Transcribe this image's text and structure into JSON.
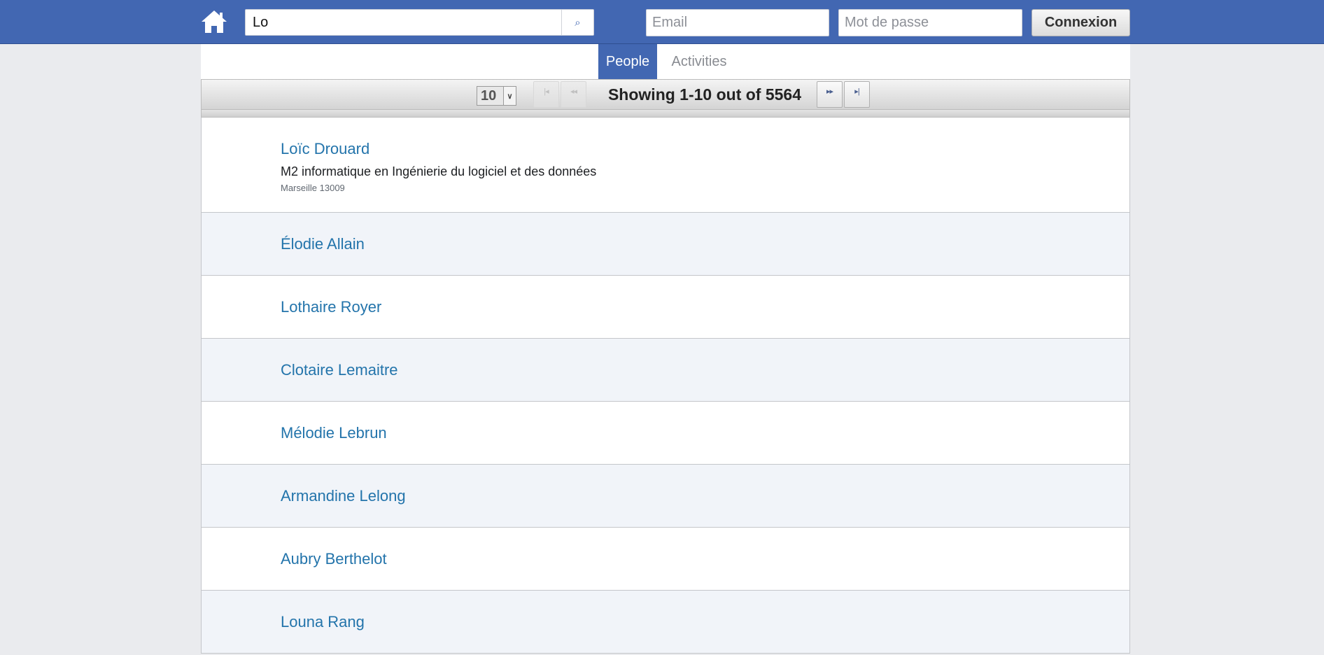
{
  "header": {
    "search_value": "Lo",
    "email_placeholder": "Email",
    "password_placeholder": "Mot de passe",
    "connect_label": "Connexion"
  },
  "tabs": [
    {
      "label": "People"
    },
    {
      "label": "Activities"
    }
  ],
  "pager": {
    "page_size": "10",
    "showing": "Showing 1-10 out of 5564"
  },
  "people": [
    {
      "name": "Loïc Drouard",
      "description": "M2 informatique en Ingénierie du logiciel et des données",
      "location": "Marseille 13009"
    },
    {
      "name": "Élodie Allain"
    },
    {
      "name": "Lothaire Royer"
    },
    {
      "name": "Clotaire Lemaitre"
    },
    {
      "name": "Mélodie Lebrun"
    },
    {
      "name": "Armandine Lelong"
    },
    {
      "name": "Aubry Berthelot"
    },
    {
      "name": "Louna Rang"
    }
  ],
  "colors": {
    "brand": "#4267b2",
    "link": "#2374ab"
  }
}
